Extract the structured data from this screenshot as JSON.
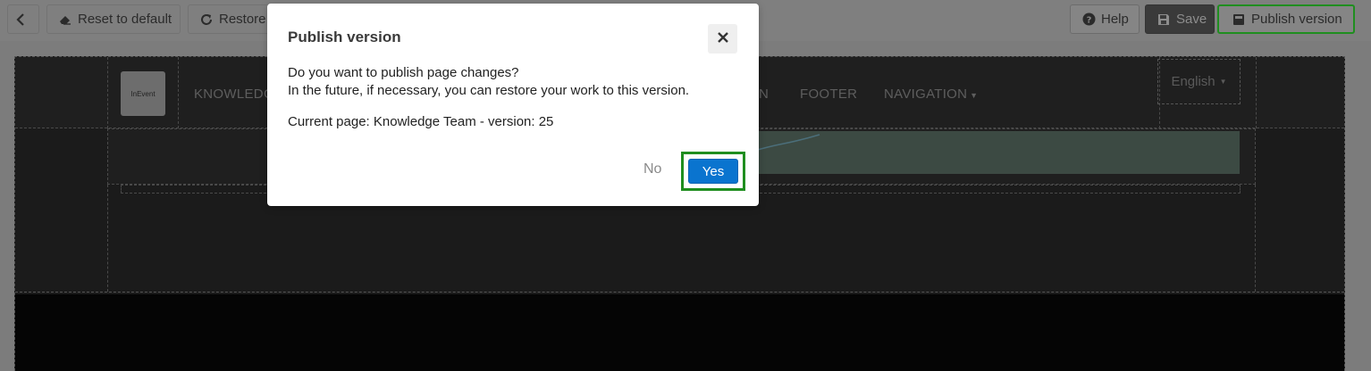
{
  "toolbar": {
    "back_icon": "chevron-left-icon",
    "reset_label": "Reset to default",
    "reset_icon": "eraser-icon",
    "restore_label": "Restore",
    "restore_icon": "refresh-icon",
    "help_label": "Help",
    "help_icon": "question-circle-icon",
    "save_label": "Save",
    "save_icon": "floppy-disk-icon",
    "publish_label": "Publish version",
    "publish_icon": "book-icon",
    "highlight_color": "#1f8e1f"
  },
  "preview": {
    "logo_text": "InEvent",
    "nav": [
      "KNOWLEDG",
      "N",
      "FOOTER",
      "NAVIGATION"
    ],
    "language": "English"
  },
  "modal": {
    "title": "Publish version",
    "close_icon": "close-icon",
    "line1": "Do you want to publish page changes?",
    "line2": "In the future, if necessary, you can restore your work to this version.",
    "current": "Current page: Knowledge Team - version: 25",
    "no_label": "No",
    "yes_label": "Yes",
    "yes_color": "#0a74cf"
  }
}
